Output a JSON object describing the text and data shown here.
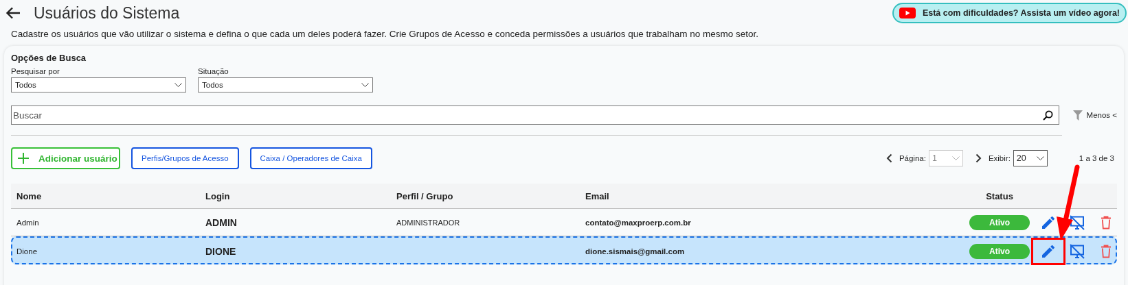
{
  "header": {
    "title": "Usuários do Sistema",
    "help_button": "Está com dificuldades? Assista um vídeo agora!"
  },
  "description": "Cadastre os usuários que vão utilizar o sistema e defina o que cada um deles poderá fazer. Crie Grupos de Acesso e conceda permissões a usuários que trabalham no mesmo setor.",
  "search_options": {
    "title": "Opções de Busca",
    "filters": [
      {
        "label": "Pesquisar por",
        "value": "Todos"
      },
      {
        "label": "Situação",
        "value": "Todos"
      }
    ],
    "search": {
      "placeholder": "Buscar"
    },
    "toggle": "Menos <"
  },
  "actions": [
    {
      "label": "Adicionar usuário",
      "kind": "add"
    },
    {
      "label": "Perfis/Grupos de Acesso",
      "kind": "outline"
    },
    {
      "label": "Caixa / Operadores de Caixa",
      "kind": "outline"
    }
  ],
  "pagination": {
    "page_label": "Página:",
    "page": "1",
    "page_disabled": true,
    "show_label": "Exibir:",
    "per_page": "20",
    "range": "1 a 3 de 3"
  },
  "table": {
    "columns": [
      "Nome",
      "Login",
      "Perfil / Grupo",
      "Email",
      "Status"
    ],
    "rows": [
      {
        "name": "Admin",
        "login": "ADMIN",
        "profile": "ADMINISTRADOR",
        "email": "contato@maxproerp.com.br",
        "status": "Ativo",
        "selected": false,
        "edit_highlighted": false
      },
      {
        "name": "Dione",
        "login": "DIONE",
        "email": "dione.sismais@gmail.com",
        "status": "Ativo",
        "selected": true,
        "edit_highlighted": true
      }
    ]
  }
}
